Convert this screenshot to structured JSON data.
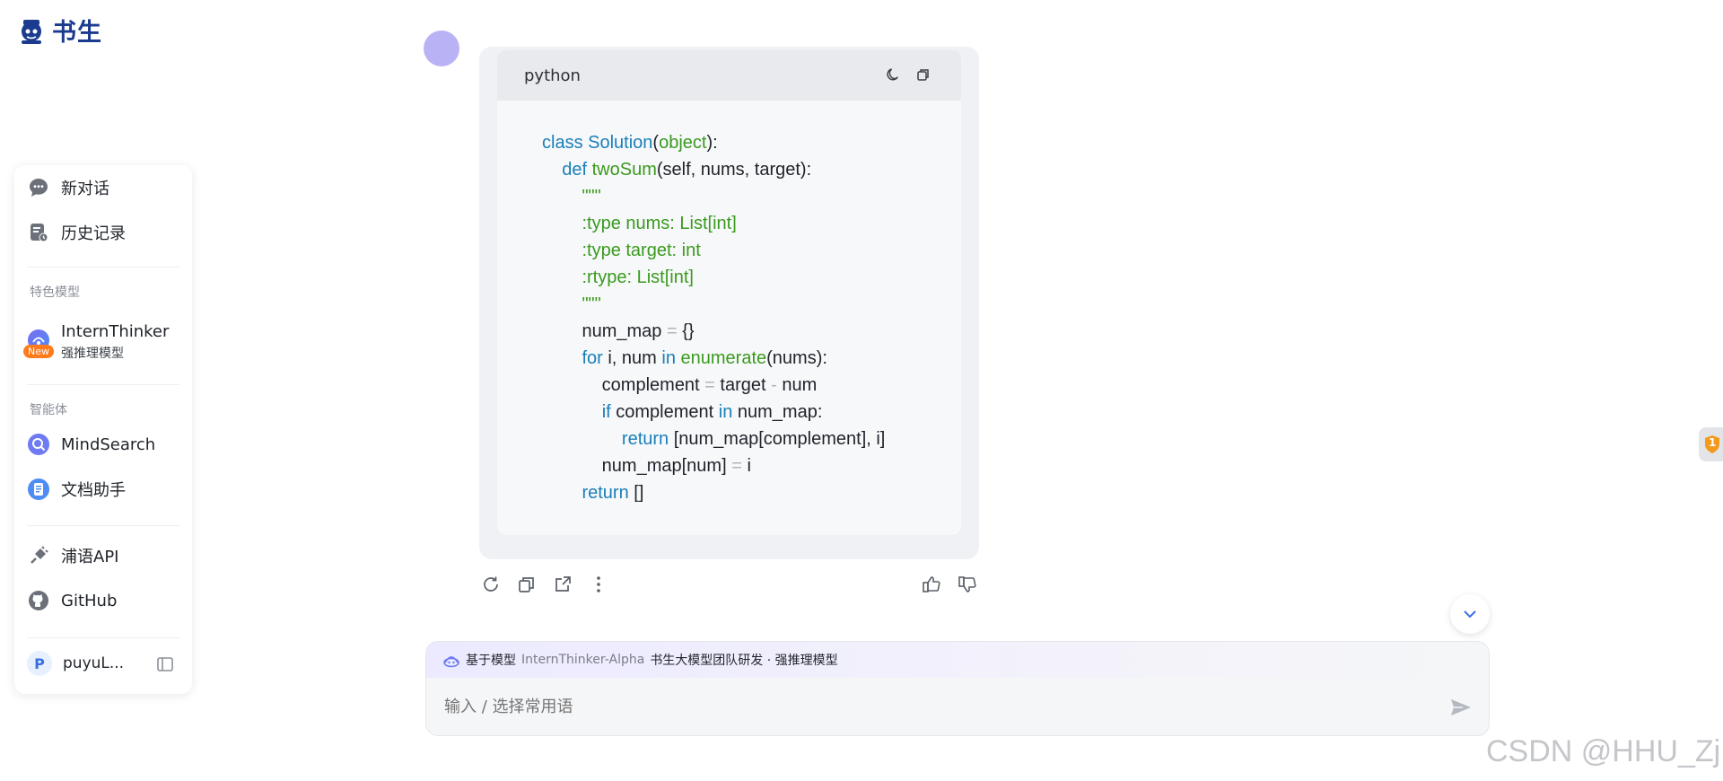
{
  "brand": {
    "name": "书生"
  },
  "sidebar": {
    "new_chat": "新对话",
    "history": "历史记录",
    "featured_label": "特色模型",
    "model_name": "InternThinker",
    "model_sub": "强推理模型",
    "new_badge": "New",
    "agents_label": "智能体",
    "mindsearch": "MindSearch",
    "doc_assistant": "文档助手",
    "api": "浦语API",
    "github": "GitHub",
    "user_initial": "P",
    "user_name": "puyuL..."
  },
  "code_block": {
    "language": "python",
    "lines": [
      "class Solution(object):",
      "    def twoSum(self, nums, target):",
      "        \"\"\"",
      "        :type nums: List[int]",
      "        :type target: int",
      "        :rtype: List[int]",
      "        \"\"\"",
      "        num_map = {}",
      "        for i, num in enumerate(nums):",
      "            complement = target - num",
      "            if complement in num_map:",
      "                return [num_map[complement], i]",
      "            num_map[num] = i",
      "        return []"
    ]
  },
  "notification": {
    "count": "1"
  },
  "input": {
    "model_prefix": "基于模型",
    "model_name": "InternThinker-Alpha",
    "model_desc": "书生大模型团队研发 · 强推理模型",
    "placeholder": "输入 / 选择常用语"
  },
  "watermark": "CSDN @HHU_Zj",
  "colors": {
    "accent": "#1b3b8f",
    "keyword": "#1a7fb8",
    "function": "#3a9a1e",
    "badge": "#ff7a1a"
  }
}
